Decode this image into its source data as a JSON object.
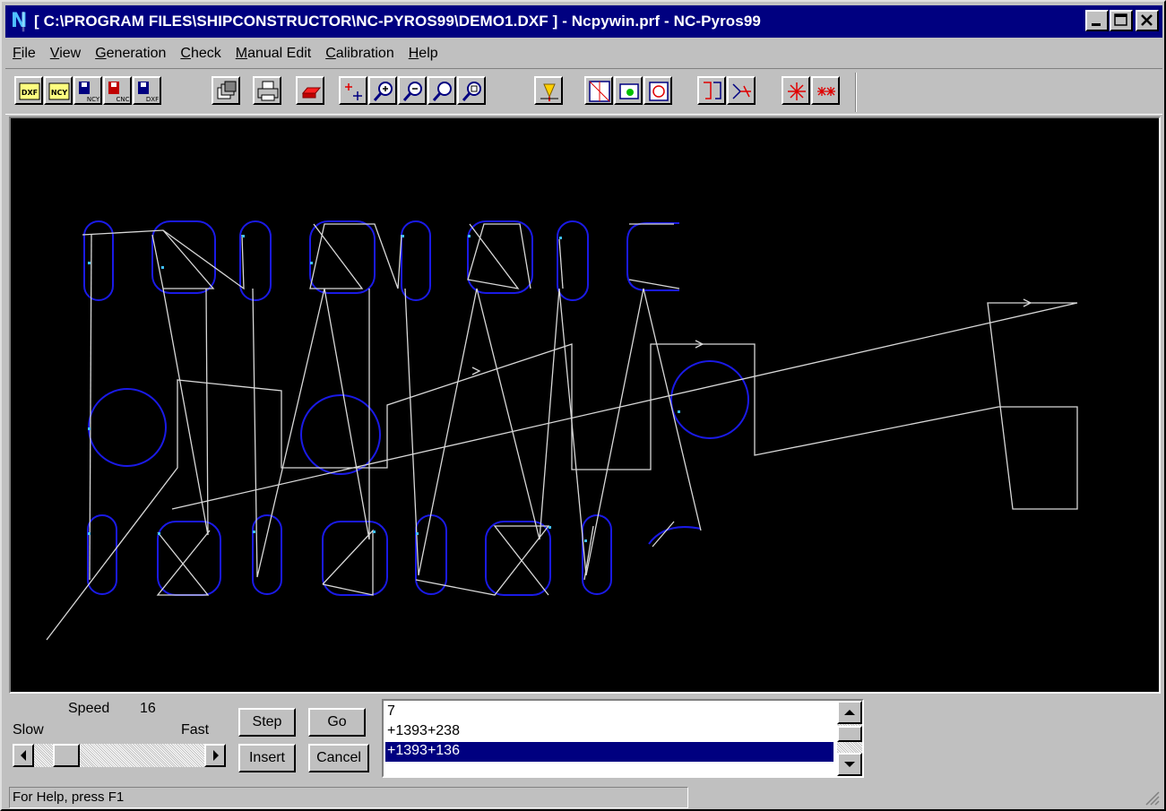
{
  "window": {
    "title": "[ C:\\PROGRAM FILES\\SHIPCONSTRUCTOR\\NC-PYROS99\\DEMO1.DXF ] - Ncpywin.prf - NC-Pyros99",
    "app_icon_label": "N"
  },
  "menu": [
    "File",
    "View",
    "Generation",
    "Check",
    "Manual Edit",
    "Calibration",
    "Help"
  ],
  "toolbar": {
    "buttons": [
      {
        "name": "open-dxf",
        "label": "DXF"
      },
      {
        "name": "open-ncy",
        "label": "NCY"
      },
      {
        "name": "save-ncy",
        "label": "NCY"
      },
      {
        "name": "save-cnc",
        "label": "CNC"
      },
      {
        "name": "save-dxf",
        "label": "DXF"
      },
      {
        "name": "copy-window",
        "label": ""
      },
      {
        "name": "print",
        "label": ""
      },
      {
        "name": "eraser",
        "label": ""
      },
      {
        "name": "add-point",
        "label": ""
      },
      {
        "name": "zoom-in",
        "label": ""
      },
      {
        "name": "zoom-out",
        "label": ""
      },
      {
        "name": "zoom-fit",
        "label": ""
      },
      {
        "name": "zoom-window",
        "label": ""
      },
      {
        "name": "torch",
        "label": ""
      },
      {
        "name": "view-parts",
        "label": ""
      },
      {
        "name": "view-part-select",
        "label": ""
      },
      {
        "name": "view-rotate",
        "label": ""
      },
      {
        "name": "mirror",
        "label": ""
      },
      {
        "name": "cut-path",
        "label": ""
      },
      {
        "name": "marker-star",
        "label": ""
      },
      {
        "name": "marker-double-star",
        "label": ""
      }
    ]
  },
  "simulation": {
    "speed_label": "Speed",
    "speed_value": "16",
    "speed_fraction": 0.13,
    "slow_label": "Slow",
    "fast_label": "Fast",
    "step_label": "Step",
    "go_label": "Go",
    "insert_label": "Insert",
    "cancel_label": "Cancel"
  },
  "coords_list": {
    "rows": [
      "7",
      "+1393+238",
      "+1393+136"
    ],
    "selected_index": 2
  },
  "status": {
    "text": "For Help, press F1"
  },
  "colors": {
    "titlebar": "#000080",
    "canvas_bg": "#000000",
    "part_outline": "#1010e0",
    "path_line": "#d8d8d8",
    "point_marker": "#40c0ff"
  }
}
